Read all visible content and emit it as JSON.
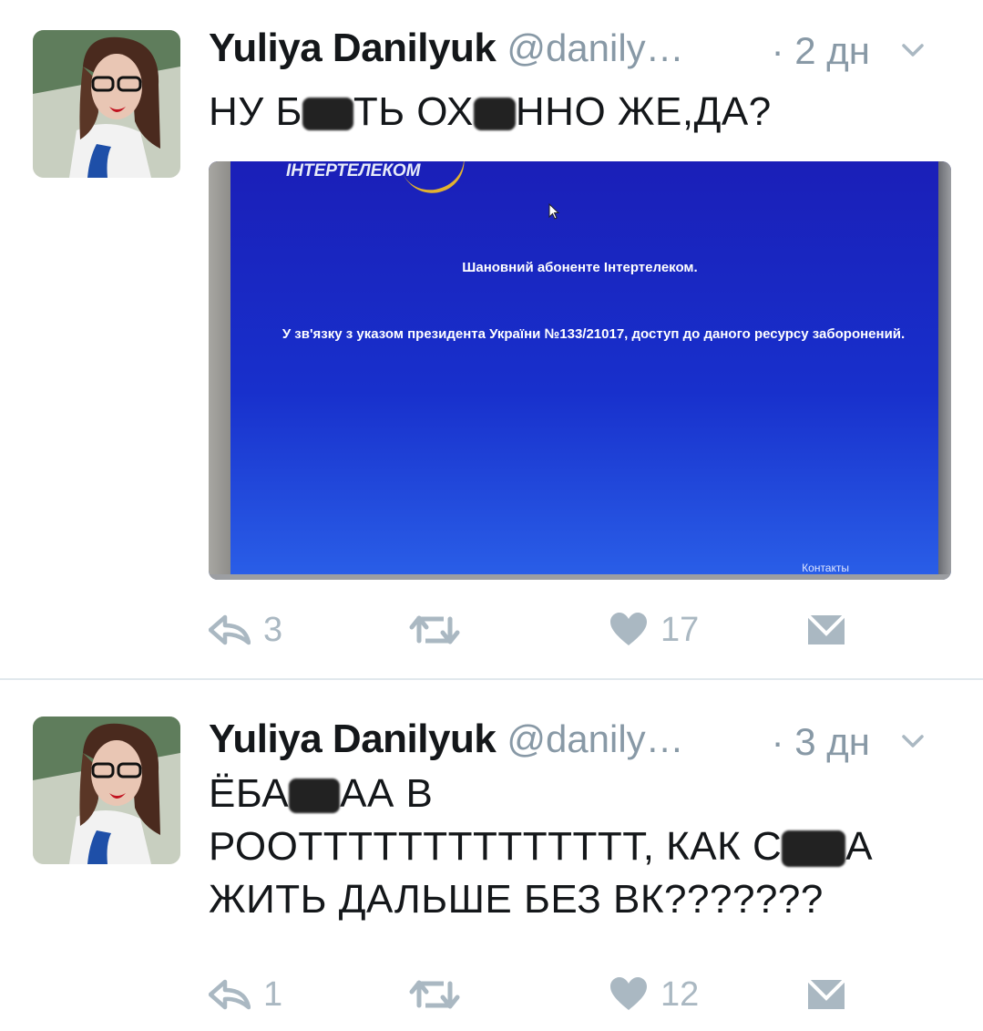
{
  "tweets": [
    {
      "author_name": "Yuliya Danilyuk⁣",
      "author_handle": "@danily…",
      "time": "· 2 дн",
      "text_parts": [
        "НУ Б",
        "ТЬ ОХ",
        "ННО ЖЕ,ДА?"
      ],
      "media": {
        "logo": "ІНТЕРТЕЛЕКОМ",
        "line1": "Шановний абоненте Інтертелеком.",
        "line2": "У зв'язку з указом президента України №133/21017, доступ до даного ресурсу заборонений.",
        "contacts": "Контакты"
      },
      "actions": {
        "replies": "3",
        "likes": "17"
      }
    },
    {
      "author_name": "Yuliya Danilyuk⁣",
      "author_handle": "@danily…",
      "time": "· 3 дн",
      "text_parts": [
        "ЁБА",
        "АА В",
        "РООТТТТТТТТТТТТТТ, КАК С",
        "А",
        "ЖИТЬ ДАЛЬШЕ БЕЗ ВК???????"
      ],
      "actions": {
        "replies": "1",
        "likes": "12"
      }
    }
  ],
  "icons": {
    "reply": "reply-icon",
    "retweet": "retweet-icon",
    "like": "heart-icon",
    "dm": "direct-message-icon",
    "more": "chevron-down-icon"
  },
  "colors": {
    "muted": "#8899a6",
    "action": "#aab8c2",
    "divider": "#e1e8ed",
    "screen_blue": "#1a2cc4"
  }
}
